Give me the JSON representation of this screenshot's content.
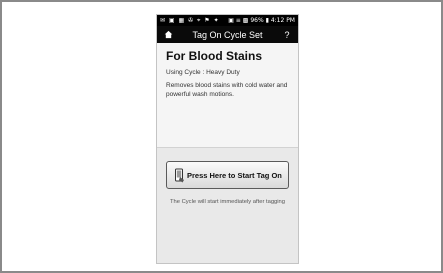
{
  "status_bar": {
    "icons_text": "✉ ▣ ▦ ✇ ⌖ ⚑ ✦",
    "signal_text": "▣ ≡ ▩",
    "battery": "96%",
    "time": "4:12 PM"
  },
  "titlebar": {
    "title": "Tag On Cycle Set",
    "help_label": "?"
  },
  "card": {
    "heading": "For Blood Stains",
    "cycle_line": "Using Cycle : Heavy Duty",
    "description": "Removes blood stains with cold water and powerful wash motions."
  },
  "tag_button": {
    "label": "Press Here to Start Tag On"
  },
  "note": "The Cycle will start immediately after tagging",
  "colors": {
    "bar": "#0a0a0a",
    "content_bg": "#f5f5f5",
    "lower_bg": "#e9e9e9"
  }
}
